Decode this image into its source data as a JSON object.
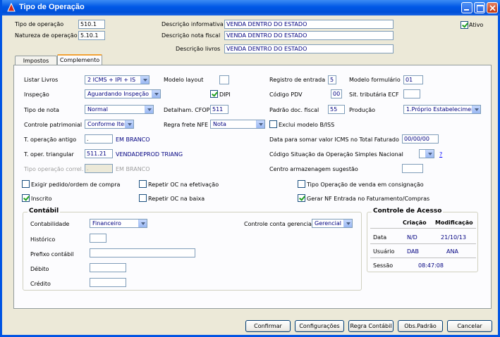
{
  "window": {
    "title": "Tipo de Operação"
  },
  "header": {
    "tipo_operacao_label": "Tipo de operação",
    "tipo_operacao_value": "510.1",
    "natureza_label": "Natureza de operação",
    "natureza_value": "5.10.1",
    "desc_informativa_label": "Descrição informativa",
    "desc_informativa_value": "VENDA DENTRO DO ESTADO",
    "desc_nota_label": "Descrição nota fiscal",
    "desc_nota_value": "VENDA DENTRO DO ESTADO",
    "desc_livros_label": "Descrição livros",
    "desc_livros_value": "VENDA DENTRO DO ESTADO",
    "ativo_label": "Ativo",
    "ativo_checked": true
  },
  "tabs": [
    {
      "label": "Impostos",
      "active": false
    },
    {
      "label": "Complemento",
      "active": true
    }
  ],
  "complemento": {
    "listar_livros_label": "Listar Livros",
    "listar_livros_value": "2 ICMS + IPI + IS",
    "modelo_layout_label": "Modelo layout",
    "modelo_layout_value": "",
    "registro_entrada_label": "Registro de entrada",
    "registro_entrada_value": "5",
    "modelo_formulario_label": "Modelo formulário",
    "modelo_formulario_value": "01",
    "inspecao_label": "Inspeção",
    "inspecao_value": "Aguardando Inspeção",
    "dipi_label": "DIPI",
    "codigo_pdv_label": "Código PDV",
    "codigo_pdv_value": "00",
    "sit_tributaria_label": "Sit. tributária ECF",
    "sit_tributaria_value": "",
    "tipo_nota_label": "Tipo de nota",
    "tipo_nota_value": "Normal",
    "detalham_cfop_label": "Detalham. CFOP",
    "detalham_cfop_value": "511",
    "padrao_doc_label": "Padrão doc. fiscal",
    "padrao_doc_value": "55",
    "producao_label": "Produção",
    "producao_value": "1.Próprio Estabelecimer",
    "controle_patrimonial_label": "Controle patrimonial",
    "controle_patrimonial_value": "Conforme Iten",
    "regra_frete_label": "Regra frete NFE",
    "regra_frete_value": "Nota",
    "exclui_modelo_label": "Exclui modelo B/ISS",
    "t_op_antigo_label": "T. operação antigo",
    "t_op_antigo_value": ".",
    "t_op_antigo_desc": "EM BRANCO",
    "data_somar_label": "Data para somar valor ICMS no Total Faturado",
    "data_somar_value": "00/00/00",
    "t_oper_triangular_label": "T. oper. triangular",
    "t_oper_triangular_value": "511.21",
    "t_oper_triangular_desc": "VENDADEPROD TRIANG",
    "codigo_situacao_label": "Código Situação da Operação Simples Nacional",
    "codigo_situacao_help": "?",
    "tipo_op_correl_label": "Tipo operação correl.",
    "tipo_op_correl_value": ".",
    "tipo_op_correl_desc": "EM BRANCO",
    "centro_armazenagem_label": "Centro armazenagem sugestão",
    "exigir_pedido_label": "Exigir pedido/ordem de compra",
    "repetir_oc_efetivacao_label": "Repetir OC na efetivação",
    "tipo_op_consignacao_label": "Tipo Operação de venda em consignação",
    "inscrito_label": "Inscrito",
    "repetir_oc_baixa_label": "Repetir OC na baixa",
    "gerar_nf_label": "Gerar NF Entrada no Faturamento/Compras"
  },
  "contabil": {
    "title": "Contábil",
    "contabilidade_label": "Contabilidade",
    "contabilidade_value": "Financeiro",
    "controle_conta_label": "Controle conta gerencial",
    "controle_conta_value": "Gerencial",
    "historico_label": "Histórico",
    "prefixo_label": "Prefixo contábil",
    "debito_label": "Débito",
    "credito_label": "Crédito"
  },
  "controle_acesso": {
    "title": "Controle de Acesso",
    "col_criacao": "Criação",
    "col_modificacao": "Modificação",
    "data_label": "Data",
    "data_criacao": "N/D",
    "data_modificacao": "21/10/13",
    "usuario_label": "Usuário",
    "usuario_criacao": "DAB",
    "usuario_modificacao": "ANA",
    "sessao_label": "Sessão",
    "sessao_value": "08:47:08"
  },
  "buttons": {
    "confirmar": "Confirmar",
    "configuracoes": "Configurações",
    "regra_contabil": "Regra Contábil",
    "obs_padrao": "Obs.Padrão",
    "cancelar": "Cancelar"
  }
}
